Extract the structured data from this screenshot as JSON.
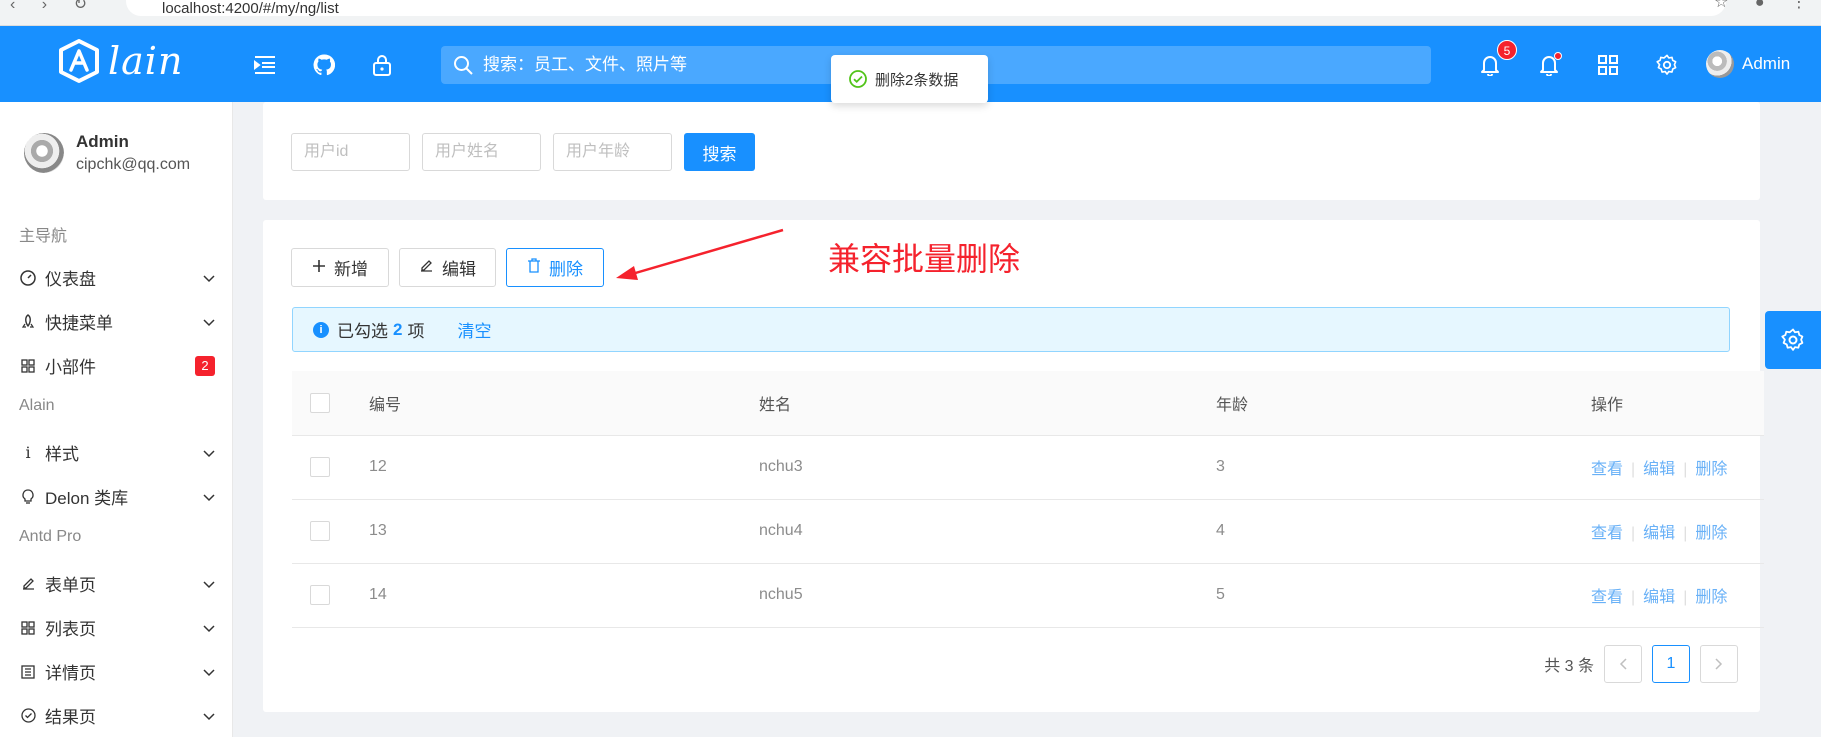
{
  "browser": {
    "url_text": "localhost:4200/#/my/ng/list"
  },
  "header": {
    "logo_text": "lain",
    "search_placeholder": "搜索：员工、文件、照片等",
    "notification_count": "5",
    "user_name": "Admin",
    "accent_color": "#1890ff"
  },
  "toast": {
    "message": "删除2条数据"
  },
  "sidebar": {
    "user": {
      "name": "Admin",
      "email": "cipchk@qq.com"
    },
    "groups": [
      {
        "title": "主导航",
        "items": [
          {
            "label": "仪表盘",
            "icon": "dashboard-icon"
          },
          {
            "label": "快捷菜单",
            "icon": "rocket-icon"
          },
          {
            "label": "小部件",
            "icon": "appstore-icon",
            "badge": "2"
          }
        ]
      },
      {
        "title": "Alain",
        "items": [
          {
            "label": "样式",
            "icon": "info-icon"
          },
          {
            "label": "Delon 类库",
            "icon": "bulb-icon"
          }
        ]
      },
      {
        "title": "Antd Pro",
        "items": [
          {
            "label": "表单页",
            "icon": "edit-icon"
          },
          {
            "label": "列表页",
            "icon": "appstore-icon"
          },
          {
            "label": "详情页",
            "icon": "profile-icon"
          },
          {
            "label": "结果页",
            "icon": "check-circle-icon"
          }
        ]
      }
    ]
  },
  "filters": {
    "user_id_placeholder": "用户id",
    "user_name_placeholder": "用户姓名",
    "user_age_placeholder": "用户年龄",
    "search_label": "搜索"
  },
  "toolbar": {
    "add_label": "新增",
    "edit_label": "编辑",
    "delete_label": "删除"
  },
  "annotation": {
    "text": "兼容批量删除"
  },
  "selection": {
    "prefix": "已勾选",
    "count": "2",
    "suffix": "项",
    "clear_label": "清空"
  },
  "table": {
    "columns": [
      "编号",
      "姓名",
      "年龄",
      "操作"
    ],
    "rows": [
      {
        "id": "12",
        "name": "nchu3",
        "age": "3"
      },
      {
        "id": "13",
        "name": "nchu4",
        "age": "4"
      },
      {
        "id": "14",
        "name": "nchu5",
        "age": "5"
      }
    ],
    "actions": {
      "view": "查看",
      "edit": "编辑",
      "delete": "删除"
    }
  },
  "pagination": {
    "total_text": "共 3 条",
    "current_page": "1"
  }
}
